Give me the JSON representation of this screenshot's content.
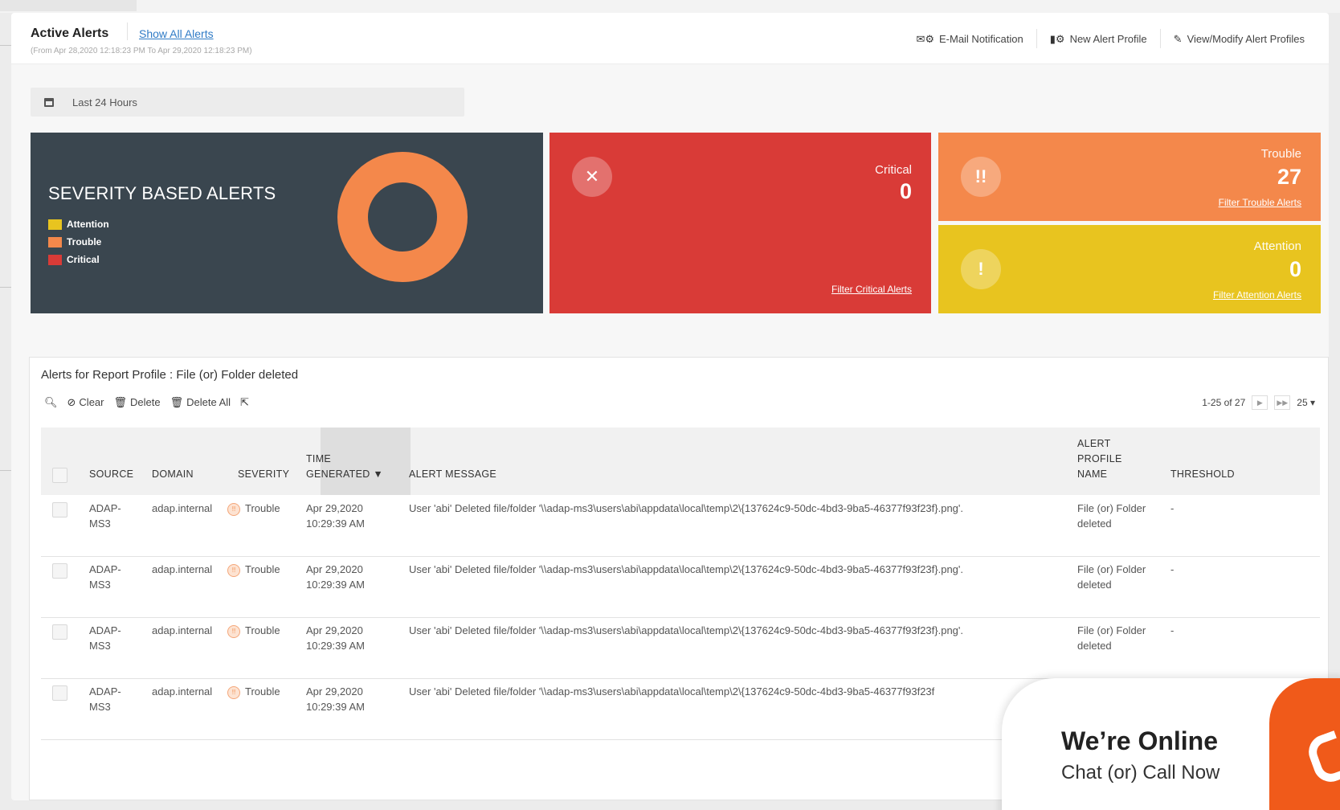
{
  "header": {
    "title": "Active Alerts",
    "show_all_link": "Show All Alerts",
    "date_range": "(From Apr 28,2020 12:18:23 PM To Apr 29,2020 12:18:23 PM)",
    "actions": [
      {
        "label": "E-Mail Notification",
        "icon": "email-settings-icon"
      },
      {
        "label": "New Alert Profile",
        "icon": "alert-profile-icon"
      },
      {
        "label": "View/Modify Alert Profiles",
        "icon": "pencil-icon"
      }
    ]
  },
  "period": {
    "label": "Last 24 Hours",
    "icon": "calendar-icon"
  },
  "severity_panel": {
    "title": "SEVERITY BASED ALERTS",
    "legend": [
      {
        "label": "Attention",
        "color": "#e8c41f"
      },
      {
        "label": "Trouble",
        "color": "#f4884b"
      },
      {
        "label": "Critical",
        "color": "#d93b37"
      }
    ],
    "donut": {
      "attention": 0,
      "trouble": 27,
      "critical": 0
    }
  },
  "cards": {
    "critical": {
      "label": "Critical",
      "count": "0",
      "link": "Filter Critical Alerts",
      "icon": "close-icon",
      "color": "#d93b37"
    },
    "trouble": {
      "label": "Trouble",
      "count": "27",
      "link": "Filter Trouble Alerts",
      "icon": "double-exclamation-icon",
      "color": "#f4884b"
    },
    "attention": {
      "label": "Attention",
      "count": "0",
      "link": "Filter Attention Alerts",
      "icon": "exclamation-icon",
      "color": "#e8c41f"
    }
  },
  "table": {
    "title": "Alerts for Report Profile : File (or) Folder deleted",
    "toolbar": {
      "clear": "Clear",
      "delete": "Delete",
      "delete_all": "Delete All"
    },
    "pager": {
      "range": "1-25 of 27",
      "page_size": "25"
    },
    "columns": {
      "source": "SOURCE",
      "domain": "DOMAIN",
      "severity": "SEVERITY",
      "time_1": "TIME",
      "time_2": "GENERATED",
      "message": "ALERT MESSAGE",
      "profile_1": "ALERT",
      "profile_2": "PROFILE",
      "profile_3": "NAME",
      "threshold": "THRESHOLD"
    },
    "rows": [
      {
        "source_1": "ADAP-",
        "source_2": "MS3",
        "domain": "adap.internal",
        "severity": "Trouble",
        "time_1": "Apr 29,2020",
        "time_2": "10:29:39 AM",
        "message": "User 'abi' Deleted file/folder '\\\\adap-ms3\\users\\abi\\appdata\\local\\temp\\2\\{137624c9-50dc-4bd3-9ba5-46377f93f23f}.png'.",
        "profile_1": "File (or) Folder",
        "profile_2": "deleted",
        "threshold": "-"
      },
      {
        "source_1": "ADAP-",
        "source_2": "MS3",
        "domain": "adap.internal",
        "severity": "Trouble",
        "time_1": "Apr 29,2020",
        "time_2": "10:29:39 AM",
        "message": "User 'abi' Deleted file/folder '\\\\adap-ms3\\users\\abi\\appdata\\local\\temp\\2\\{137624c9-50dc-4bd3-9ba5-46377f93f23f}.png'.",
        "profile_1": "File (or) Folder",
        "profile_2": "deleted",
        "threshold": "-"
      },
      {
        "source_1": "ADAP-",
        "source_2": "MS3",
        "domain": "adap.internal",
        "severity": "Trouble",
        "time_1": "Apr 29,2020",
        "time_2": "10:29:39 AM",
        "message": "User 'abi' Deleted file/folder '\\\\adap-ms3\\users\\abi\\appdata\\local\\temp\\2\\{137624c9-50dc-4bd3-9ba5-46377f93f23f}.png'.",
        "profile_1": "File (or) Folder",
        "profile_2": "deleted",
        "threshold": "-"
      },
      {
        "source_1": "ADAP-",
        "source_2": "MS3",
        "domain": "adap.internal",
        "severity": "Trouble",
        "time_1": "Apr 29,2020",
        "time_2": "10:29:39 AM",
        "message": "User 'abi' Deleted file/folder '\\\\adap-ms3\\users\\abi\\appdata\\local\\temp\\2\\{137624c9-50dc-4bd3-9ba5-46377f93f23f",
        "profile_1": "",
        "profile_2": "",
        "threshold": ""
      }
    ]
  },
  "chat": {
    "headline": "We’re Online",
    "subline": "Chat (or) Call Now",
    "icon": "phone-icon"
  }
}
